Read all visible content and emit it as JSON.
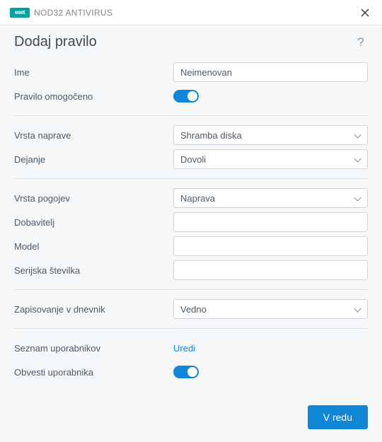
{
  "brand": {
    "logo_text": "eset",
    "product": "NOD32 ANTIVIRUS"
  },
  "header": {
    "title": "Dodaj pravilo"
  },
  "labels": {
    "name": "Ime",
    "rule_enabled": "Pravilo omogočeno",
    "device_type": "Vrsta naprave",
    "action": "Dejanje",
    "criteria_type": "Vrsta pogojev",
    "vendor": "Dobavitelj",
    "model": "Model",
    "serial": "Serijska številka",
    "logging": "Zapisovanje v dnevnik",
    "user_list": "Seznam uporabnikov",
    "notify_user": "Obvesti uporabnika"
  },
  "values": {
    "name": "Neimenovan",
    "device_type": "Shramba diska",
    "action": "Dovoli",
    "criteria_type": "Naprava",
    "vendor": "",
    "model": "",
    "serial": "",
    "logging": "Vedno",
    "user_list_link": "Uredi"
  },
  "toggles": {
    "rule_enabled": true,
    "notify_user": true
  },
  "buttons": {
    "ok": "V redu"
  }
}
